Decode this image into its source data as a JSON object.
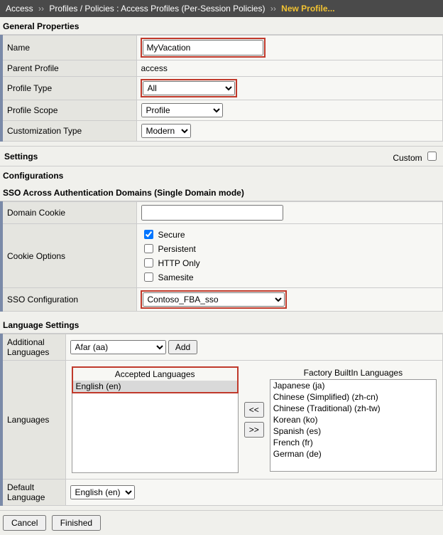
{
  "breadcrumb": {
    "root": "Access",
    "path": "Profiles / Policies : Access Profiles (Per-Session Policies)",
    "current": "New Profile..."
  },
  "sections": {
    "general": "General Properties",
    "settings": "Settings",
    "custom_label": "Custom",
    "configurations": "Configurations",
    "sso_domains": "SSO Across Authentication Domains (Single Domain mode)",
    "language": "Language Settings"
  },
  "general": {
    "name_label": "Name",
    "name_value": "MyVacation",
    "parent_label": "Parent Profile",
    "parent_value": "access",
    "type_label": "Profile Type",
    "type_value": "All",
    "scope_label": "Profile Scope",
    "scope_value": "Profile",
    "cust_label": "Customization Type",
    "cust_value": "Modern"
  },
  "sso": {
    "domain_cookie_label": "Domain Cookie",
    "domain_cookie_value": "",
    "cookie_opts_label": "Cookie Options",
    "opts": {
      "secure": "Secure",
      "persistent": "Persistent",
      "httponly": "HTTP Only",
      "samesite": "Samesite"
    },
    "sso_config_label": "SSO Configuration",
    "sso_config_value": "Contoso_FBA_sso"
  },
  "lang": {
    "additional_label": "Additional Languages",
    "additional_value": "Afar (aa)",
    "add_btn": "Add",
    "languages_label": "Languages",
    "accepted_title": "Accepted Languages",
    "factory_title": "Factory BuiltIn Languages",
    "accepted_items": [
      "English (en)"
    ],
    "factory_items": [
      "Japanese (ja)",
      "Chinese (Simplified) (zh-cn)",
      "Chinese (Traditional) (zh-tw)",
      "Korean (ko)",
      "Spanish (es)",
      "French (fr)",
      "German (de)"
    ],
    "move_left": "<<",
    "move_right": ">>",
    "default_label": "Default Language",
    "default_value": "English (en)"
  },
  "footer": {
    "cancel": "Cancel",
    "finished": "Finished"
  }
}
